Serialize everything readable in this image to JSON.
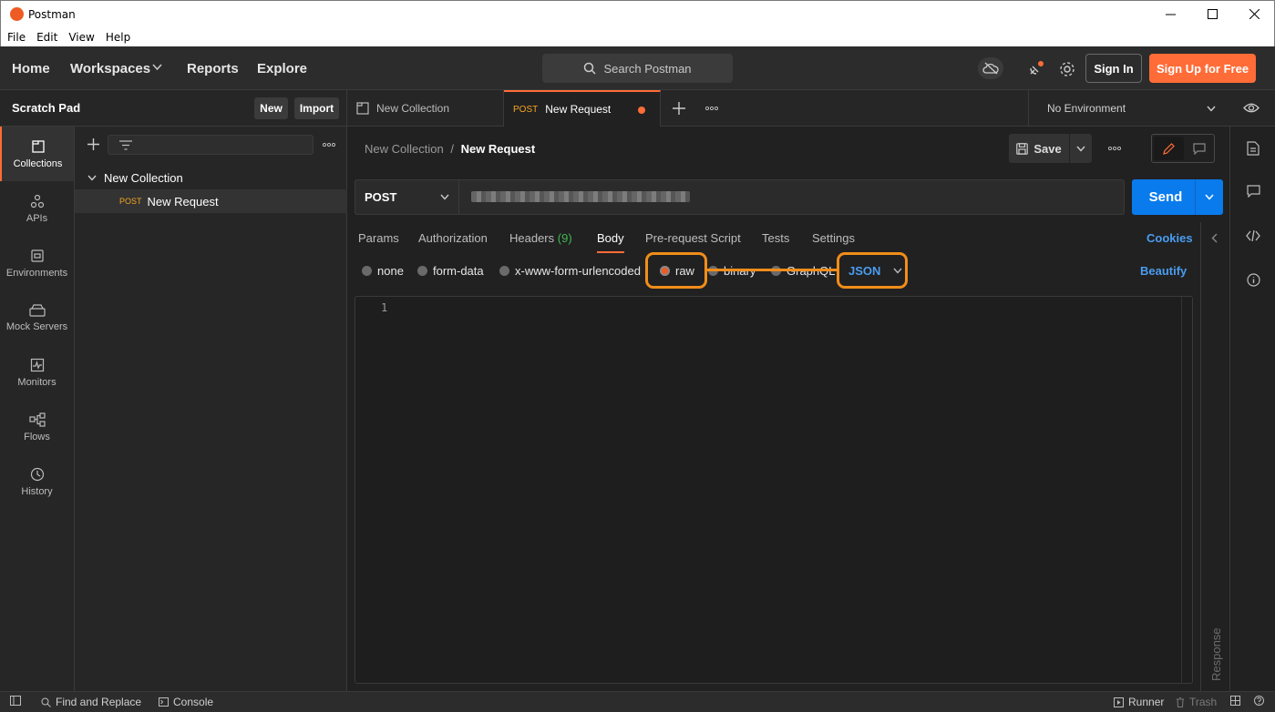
{
  "window": {
    "title": "Postman"
  },
  "menu": [
    "File",
    "Edit",
    "View",
    "Help"
  ],
  "header": {
    "nav": [
      "Home",
      "Workspaces",
      "Reports",
      "Explore"
    ],
    "search_placeholder": "Search Postman",
    "sign_in": "Sign In",
    "sign_up": "Sign Up for Free"
  },
  "sidebar": {
    "workspace_title": "Scratch Pad",
    "new_label": "New",
    "import_label": "Import",
    "rail": [
      "Collections",
      "APIs",
      "Environments",
      "Mock Servers",
      "Monitors",
      "Flows",
      "History"
    ],
    "tree": {
      "collection": "New Collection",
      "request_method": "POST",
      "request_name": "New Request"
    }
  },
  "tabs": {
    "collection_tab": "New Collection",
    "request_tab_method": "POST",
    "request_tab_name": "New Request",
    "environment": "No Environment"
  },
  "request": {
    "breadcrumb_parent": "New Collection",
    "breadcrumb_sep": "/",
    "breadcrumb_current": "New Request",
    "save_label": "Save",
    "method": "POST",
    "send_label": "Send",
    "subtabs": {
      "params": "Params",
      "authorization": "Authorization",
      "headers": "Headers",
      "headers_count": "(9)",
      "body": "Body",
      "prerequest": "Pre-request Script",
      "tests": "Tests",
      "settings": "Settings"
    },
    "cookies": "Cookies",
    "body_modes": {
      "none": "none",
      "form_data": "form-data",
      "urlencoded": "x-www-form-urlencoded",
      "raw": "raw",
      "binary": "binary",
      "graphql": "GraphQL"
    },
    "selected_mode": "raw",
    "format": "JSON",
    "beautify": "Beautify",
    "line_number": "1",
    "response_label": "Response"
  },
  "statusbar": {
    "find_replace": "Find and Replace",
    "console": "Console",
    "runner": "Runner",
    "trash": "Trash"
  },
  "colors": {
    "accent": "#ff6c37",
    "send": "#097bed",
    "link": "#4a9cf0",
    "highlight": "#f28d1a"
  }
}
